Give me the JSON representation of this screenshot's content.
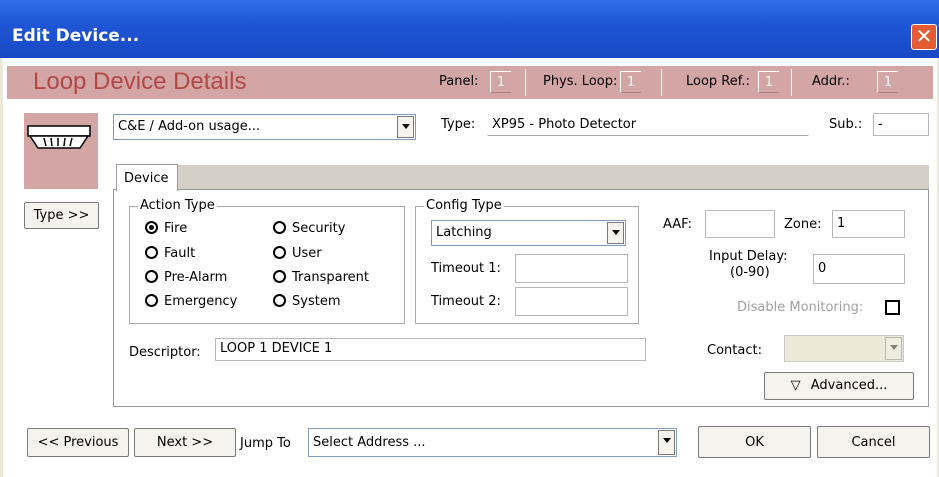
{
  "window": {
    "title": "Edit Device...",
    "close_glyph": "✕"
  },
  "banner": {
    "heading": "Loop Device Details",
    "panel_label": "Panel:",
    "panel_value": "1",
    "phys_loop_label": "Phys. Loop:",
    "phys_loop_value": "1",
    "loop_ref_label": "Loop Ref.:",
    "loop_ref_value": "1",
    "addr_label": "Addr.:",
    "addr_value": "1"
  },
  "device_icon": "detector-base-icon",
  "type_button": "Type >>",
  "usage": {
    "selected": "C&E / Add-on usage..."
  },
  "type": {
    "label": "Type:",
    "value": "XP95 - Photo Detector"
  },
  "sub": {
    "label": "Sub.:",
    "value": "-"
  },
  "tabs": [
    {
      "label": "Device"
    }
  ],
  "action_type": {
    "title": "Action Type",
    "options": [
      {
        "label": "Fire",
        "selected": true
      },
      {
        "label": "Security",
        "selected": false
      },
      {
        "label": "Fault",
        "selected": false
      },
      {
        "label": "User",
        "selected": false
      },
      {
        "label": "Pre-Alarm",
        "selected": false
      },
      {
        "label": "Transparent",
        "selected": false
      },
      {
        "label": "Emergency",
        "selected": false
      },
      {
        "label": "System",
        "selected": false
      }
    ]
  },
  "config_type": {
    "title": "Config Type",
    "selected": "Latching",
    "timeout1_label": "Timeout 1:",
    "timeout1_value": "",
    "timeout2_label": "Timeout 2:",
    "timeout2_value": ""
  },
  "aaf": {
    "label": "AAF:",
    "value": ""
  },
  "zone": {
    "label": "Zone:",
    "value": "1"
  },
  "input_delay": {
    "label_line1": "Input Delay:",
    "label_line2": "(0-90)",
    "value": "0"
  },
  "disable_monitoring": {
    "label": "Disable Monitoring:",
    "checked": false
  },
  "descriptor": {
    "label": "Descriptor:",
    "value": "LOOP 1 DEVICE 1"
  },
  "contact": {
    "label": "Contact:",
    "value": ""
  },
  "advanced_button": {
    "glyph": "▽",
    "label": "Advanced..."
  },
  "footer": {
    "previous": "<< Previous",
    "next": "Next >>",
    "jump_to_label": "Jump To",
    "jump_to_selected": "Select Address ...",
    "ok": "OK",
    "cancel": "Cancel"
  }
}
